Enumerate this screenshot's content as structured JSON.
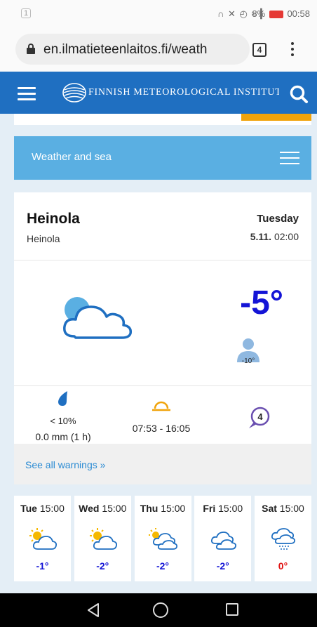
{
  "status_bar": {
    "notification_badge": "1",
    "icons": [
      "headphones-icon",
      "mute-icon",
      "alarm-icon",
      "wifi-icon",
      "signal-icon"
    ],
    "battery_percent": "8%",
    "time": "00:58"
  },
  "browser": {
    "url": "en.ilmatieteenlaitos.fi/weath",
    "tab_count": "4"
  },
  "site": {
    "title": "FINNISH METEOROLOGICAL INSTITUTE",
    "header_color": "#1f6fc1",
    "accent_color": "#f0a30a"
  },
  "nav_section": {
    "label": "Weather and sea"
  },
  "current": {
    "city": "Heinola",
    "subcity": "Heinola",
    "day": "Tuesday",
    "date": "5.11.",
    "time": "02:00",
    "icon": "cloudy-icon",
    "temperature": "-5°",
    "feels_like": "-10°",
    "temperature_color": "#1414d6",
    "precip_probability": "< 10%",
    "precip_amount": "0.0 mm (1 h)",
    "sun_times": "07:53 - 16:05",
    "warnings_count": "4",
    "warnings_link": "See all warnings »"
  },
  "forecast": [
    {
      "day": "Tue",
      "time": "15:00",
      "icon": "partly-sunny-icon",
      "temp": "-1°",
      "color": "#1414d6"
    },
    {
      "day": "Wed",
      "time": "15:00",
      "icon": "partly-sunny-icon",
      "temp": "-2°",
      "color": "#1414d6"
    },
    {
      "day": "Thu",
      "time": "15:00",
      "icon": "partly-cloudy-icon",
      "temp": "-2°",
      "color": "#1414d6"
    },
    {
      "day": "Fri",
      "time": "15:00",
      "icon": "cloudy-icon",
      "temp": "-2°",
      "color": "#1414d6"
    },
    {
      "day": "Sat",
      "time": "15:00",
      "icon": "sleet-icon",
      "temp": "0°",
      "color": "#e01010"
    }
  ]
}
